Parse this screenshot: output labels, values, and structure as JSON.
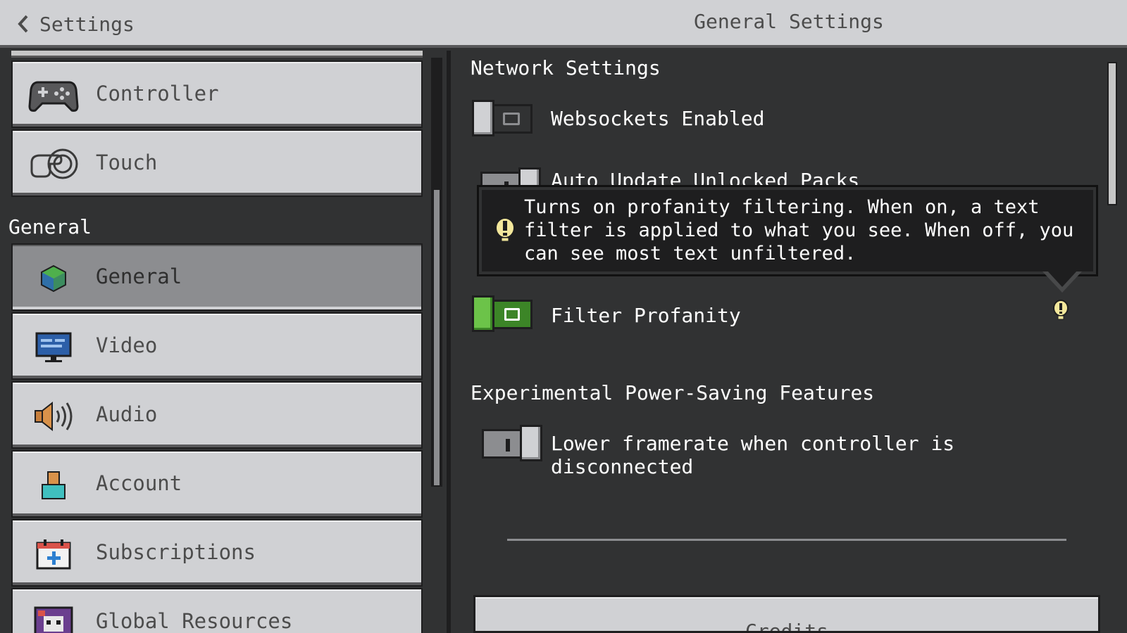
{
  "header": {
    "back_label": "Settings",
    "title": "General Settings"
  },
  "sidebar": {
    "section_general": "General",
    "items": [
      {
        "label": "Controller",
        "icon": "controller-icon"
      },
      {
        "label": "Touch",
        "icon": "touch-icon"
      },
      {
        "label": "General",
        "icon": "cube-icon",
        "selected": true
      },
      {
        "label": "Video",
        "icon": "monitor-icon"
      },
      {
        "label": "Audio",
        "icon": "speaker-icon"
      },
      {
        "label": "Account",
        "icon": "account-icon"
      },
      {
        "label": "Subscriptions",
        "icon": "subscriptions-icon"
      },
      {
        "label": "Global Resources",
        "icon": "global-resources-icon"
      }
    ]
  },
  "content": {
    "network_title": "Network Settings",
    "websockets_label": "Websockets Enabled",
    "websockets_on": false,
    "auto_update_label": "Auto Update Unlocked Packs",
    "auto_update_on": false,
    "tooltip": "Turns on profanity filtering. When on, a text filter is applied to what you see. When off, you can see most text unfiltered.",
    "filter_label": "Filter Profanity",
    "filter_on": true,
    "power_title": "Experimental Power-Saving Features",
    "lower_framerate_label": "Lower framerate when controller is disconnected",
    "lower_framerate_on": false,
    "credits_label": "Credits"
  },
  "colors": {
    "accent_green": "#3c8527",
    "tooltip_icon_yellow": "#f3e79b",
    "panel": "#d0d1d4"
  }
}
